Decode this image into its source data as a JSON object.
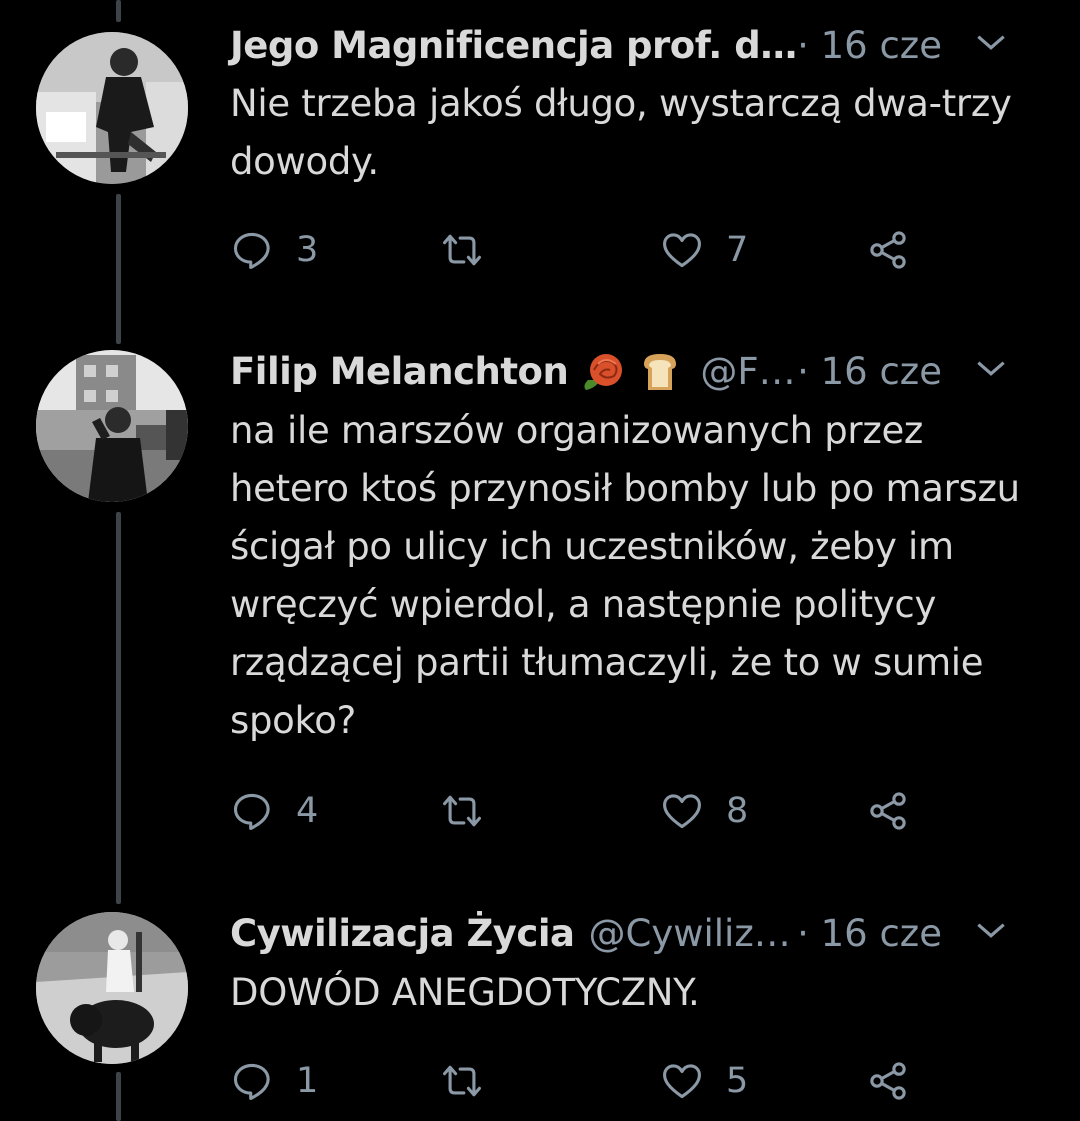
{
  "tweets": [
    {
      "author": "Jego Magnificencja prof. d…",
      "handle": "",
      "separator_time": "· 16 cze",
      "text": "Nie trzeba jakoś długo, wystarczą dwa-trzy dowody.",
      "replies": "3",
      "retweets": "",
      "likes": "7"
    },
    {
      "author": "Filip Melanchton",
      "handle": "@F…",
      "separator_time": "· 16 cze",
      "emojis": [
        "rose-icon",
        "bread-icon"
      ],
      "text": "na ile marszów organizowanych przez hetero ktoś przynosił bomby lub po marszu ścigał po ulicy ich uczestników, żeby im wręczyć wpierdol, a następnie politycy rządzącej partii tłumaczyli, że to w sumie spoko?",
      "replies": "4",
      "retweets": "",
      "likes": "8"
    },
    {
      "author": "Cywilizacja Życia",
      "handle": "@Cywiliz…",
      "separator_time": "· 16 cze",
      "text": "DOWÓD ANEGDOTYCZNY.",
      "replies": "1",
      "retweets": "",
      "likes": "5"
    }
  ],
  "colors": {
    "background": "#000000",
    "text": "#d9d9d9",
    "secondary": "#8b98a5",
    "thread_line": "#3d4349"
  },
  "icons": [
    "reply-icon",
    "retweet-icon",
    "like-icon",
    "share-icon",
    "chevron-down-icon"
  ]
}
